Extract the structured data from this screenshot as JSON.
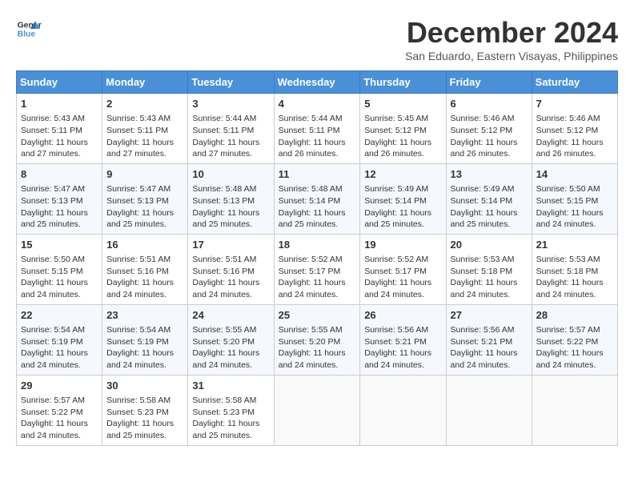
{
  "header": {
    "logo_line1": "General",
    "logo_line2": "Blue",
    "month": "December 2024",
    "location": "San Eduardo, Eastern Visayas, Philippines"
  },
  "weekdays": [
    "Sunday",
    "Monday",
    "Tuesday",
    "Wednesday",
    "Thursday",
    "Friday",
    "Saturday"
  ],
  "weeks": [
    [
      {
        "day": "1",
        "sunrise": "5:43 AM",
        "sunset": "5:11 PM",
        "daylight": "11 hours and 27 minutes."
      },
      {
        "day": "2",
        "sunrise": "5:43 AM",
        "sunset": "5:11 PM",
        "daylight": "11 hours and 27 minutes."
      },
      {
        "day": "3",
        "sunrise": "5:44 AM",
        "sunset": "5:11 PM",
        "daylight": "11 hours and 27 minutes."
      },
      {
        "day": "4",
        "sunrise": "5:44 AM",
        "sunset": "5:11 PM",
        "daylight": "11 hours and 26 minutes."
      },
      {
        "day": "5",
        "sunrise": "5:45 AM",
        "sunset": "5:12 PM",
        "daylight": "11 hours and 26 minutes."
      },
      {
        "day": "6",
        "sunrise": "5:46 AM",
        "sunset": "5:12 PM",
        "daylight": "11 hours and 26 minutes."
      },
      {
        "day": "7",
        "sunrise": "5:46 AM",
        "sunset": "5:12 PM",
        "daylight": "11 hours and 26 minutes."
      }
    ],
    [
      {
        "day": "8",
        "sunrise": "5:47 AM",
        "sunset": "5:13 PM",
        "daylight": "11 hours and 25 minutes."
      },
      {
        "day": "9",
        "sunrise": "5:47 AM",
        "sunset": "5:13 PM",
        "daylight": "11 hours and 25 minutes."
      },
      {
        "day": "10",
        "sunrise": "5:48 AM",
        "sunset": "5:13 PM",
        "daylight": "11 hours and 25 minutes."
      },
      {
        "day": "11",
        "sunrise": "5:48 AM",
        "sunset": "5:14 PM",
        "daylight": "11 hours and 25 minutes."
      },
      {
        "day": "12",
        "sunrise": "5:49 AM",
        "sunset": "5:14 PM",
        "daylight": "11 hours and 25 minutes."
      },
      {
        "day": "13",
        "sunrise": "5:49 AM",
        "sunset": "5:14 PM",
        "daylight": "11 hours and 25 minutes."
      },
      {
        "day": "14",
        "sunrise": "5:50 AM",
        "sunset": "5:15 PM",
        "daylight": "11 hours and 24 minutes."
      }
    ],
    [
      {
        "day": "15",
        "sunrise": "5:50 AM",
        "sunset": "5:15 PM",
        "daylight": "11 hours and 24 minutes."
      },
      {
        "day": "16",
        "sunrise": "5:51 AM",
        "sunset": "5:16 PM",
        "daylight": "11 hours and 24 minutes."
      },
      {
        "day": "17",
        "sunrise": "5:51 AM",
        "sunset": "5:16 PM",
        "daylight": "11 hours and 24 minutes."
      },
      {
        "day": "18",
        "sunrise": "5:52 AM",
        "sunset": "5:17 PM",
        "daylight": "11 hours and 24 minutes."
      },
      {
        "day": "19",
        "sunrise": "5:52 AM",
        "sunset": "5:17 PM",
        "daylight": "11 hours and 24 minutes."
      },
      {
        "day": "20",
        "sunrise": "5:53 AM",
        "sunset": "5:18 PM",
        "daylight": "11 hours and 24 minutes."
      },
      {
        "day": "21",
        "sunrise": "5:53 AM",
        "sunset": "5:18 PM",
        "daylight": "11 hours and 24 minutes."
      }
    ],
    [
      {
        "day": "22",
        "sunrise": "5:54 AM",
        "sunset": "5:19 PM",
        "daylight": "11 hours and 24 minutes."
      },
      {
        "day": "23",
        "sunrise": "5:54 AM",
        "sunset": "5:19 PM",
        "daylight": "11 hours and 24 minutes."
      },
      {
        "day": "24",
        "sunrise": "5:55 AM",
        "sunset": "5:20 PM",
        "daylight": "11 hours and 24 minutes."
      },
      {
        "day": "25",
        "sunrise": "5:55 AM",
        "sunset": "5:20 PM",
        "daylight": "11 hours and 24 minutes."
      },
      {
        "day": "26",
        "sunrise": "5:56 AM",
        "sunset": "5:21 PM",
        "daylight": "11 hours and 24 minutes."
      },
      {
        "day": "27",
        "sunrise": "5:56 AM",
        "sunset": "5:21 PM",
        "daylight": "11 hours and 24 minutes."
      },
      {
        "day": "28",
        "sunrise": "5:57 AM",
        "sunset": "5:22 PM",
        "daylight": "11 hours and 24 minutes."
      }
    ],
    [
      {
        "day": "29",
        "sunrise": "5:57 AM",
        "sunset": "5:22 PM",
        "daylight": "11 hours and 24 minutes."
      },
      {
        "day": "30",
        "sunrise": "5:58 AM",
        "sunset": "5:23 PM",
        "daylight": "11 hours and 25 minutes."
      },
      {
        "day": "31",
        "sunrise": "5:58 AM",
        "sunset": "5:23 PM",
        "daylight": "11 hours and 25 minutes."
      },
      null,
      null,
      null,
      null
    ]
  ]
}
